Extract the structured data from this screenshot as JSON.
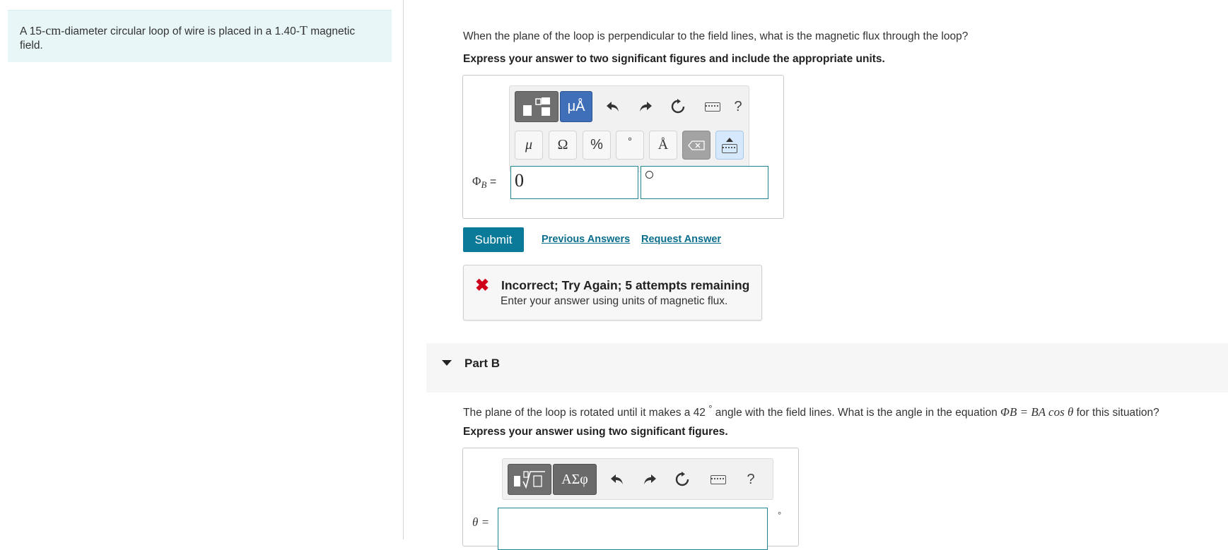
{
  "problem": {
    "text_pre": "A 15-",
    "unit_cm": "cm",
    "text_mid": "-diameter circular loop of wire is placed in a 1.40-",
    "unit_T": "T",
    "text_post": " magnetic field."
  },
  "partA": {
    "question": "When the plane of the loop is perpendicular to the field lines, what is the magnetic flux through the loop?",
    "instruction": "Express your answer to two significant figures and include the appropriate units.",
    "toolbar": {
      "units_button": "μÅ",
      "help": "?",
      "symbols": [
        "μ",
        "Ω",
        "%",
        "°",
        "Å"
      ]
    },
    "label": "ΦB =",
    "label_main": "Φ",
    "label_sub": "B",
    "label_eq": " =",
    "value": "0",
    "units_value": "",
    "submit": "Submit",
    "previous_answers": "Previous Answers",
    "request_answer": "Request Answer",
    "feedback": {
      "title": "Incorrect; Try Again; 5 attempts remaining",
      "message": "Enter your answer using units of magnetic flux."
    }
  },
  "partB": {
    "title": "Part B",
    "question_pre": "The plane of the loop is rotated until it makes a 42 ",
    "degree": "°",
    "question_mid": " angle with the field lines. What is the angle in the equation ",
    "equation": "ΦB = BA cos θ",
    "question_post": " for this situation?",
    "instruction": "Express your answer using two significant figures.",
    "toolbar": {
      "greek_button": "ΑΣφ",
      "help": "?"
    },
    "label": "θ =",
    "value": "",
    "unit_suffix": "°"
  },
  "colors": {
    "accent": "#0b7a99",
    "error": "#d0021b",
    "problem_bg": "#e8f6f8"
  }
}
